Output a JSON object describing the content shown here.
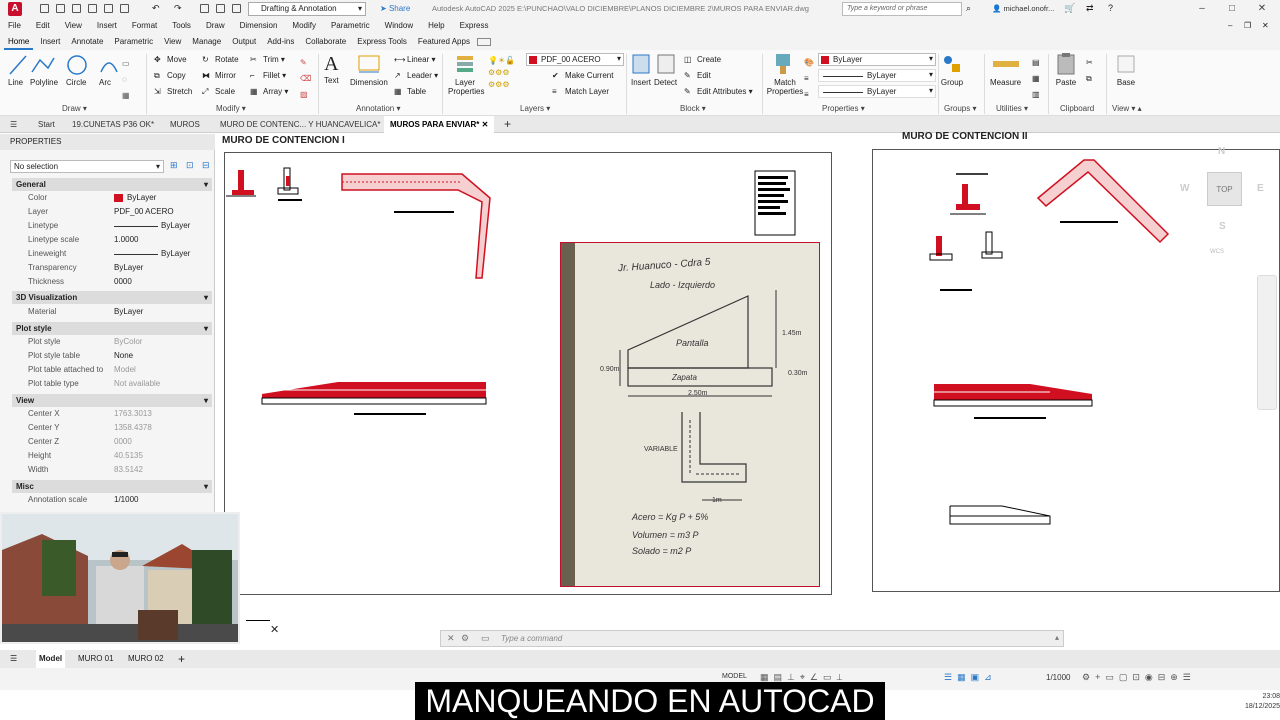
{
  "titlebar": {
    "app_logo": "A",
    "workspace": "Drafting & Annotation",
    "share": "Share",
    "title": "Autodesk AutoCAD 2025   E:\\PUNCHAO\\VALO DICIEMBRE\\PLANOS DICIEMBRE 2\\MUROS PARA ENVIAR.dwg",
    "search_placeholder": "Type a keyword or phrase",
    "user": "michael.onofr..."
  },
  "menu": [
    "File",
    "Edit",
    "View",
    "Insert",
    "Format",
    "Tools",
    "Draw",
    "Dimension",
    "Modify",
    "Parametric",
    "Window",
    "Help",
    "Express"
  ],
  "ribbon_tabs": [
    "Home",
    "Insert",
    "Annotate",
    "Parametric",
    "View",
    "Manage",
    "Output",
    "Add-ins",
    "Collaborate",
    "Express Tools",
    "Featured Apps"
  ],
  "ribbon": {
    "draw": {
      "line": "Line",
      "polyline": "Polyline",
      "circle": "Circle",
      "arc": "Arc",
      "label": "Draw"
    },
    "modify": {
      "move": "Move",
      "rotate": "Rotate",
      "trim": "Trim",
      "copy": "Copy",
      "mirror": "Mirror",
      "fillet": "Fillet",
      "stretch": "Stretch",
      "scale": "Scale",
      "array": "Array",
      "label": "Modify"
    },
    "annotation": {
      "text": "Text",
      "dimension": "Dimension",
      "linear": "Linear",
      "leader": "Leader",
      "table": "Table",
      "label": "Annotation"
    },
    "layers": {
      "layer_properties": "Layer Properties",
      "current_layer": "PDF_00 ACERO",
      "make_current": "Make Current",
      "match_layer": "Match Layer",
      "label": "Layers"
    },
    "block": {
      "insert": "Insert",
      "detect": "Detect",
      "create": "Create",
      "edit": "Edit",
      "edit_attributes": "Edit Attributes",
      "label": "Block"
    },
    "properties": {
      "match": "Match Properties",
      "color": "ByLayer",
      "linetype": "ByLayer",
      "lineweight": "ByLayer",
      "label": "Properties"
    },
    "groups": {
      "group": "Group",
      "label": "Groups"
    },
    "utilities": {
      "measure": "Measure",
      "label": "Utilities"
    },
    "clipboard": {
      "paste": "Paste",
      "label": "Clipboard"
    },
    "view": {
      "base": "Base",
      "label": "View"
    }
  },
  "doc_tabs": [
    "Start",
    "19.CUNETAS P36 OK*",
    "MUROS",
    "MURO DE CONTENC... Y HUANCAVELICA*",
    "MUROS PARA ENVIAR*"
  ],
  "properties": {
    "title": "PROPERTIES",
    "selection": "No selection",
    "sections": {
      "general": "General",
      "viz": "3D Visualization",
      "plot": "Plot style",
      "view": "View",
      "misc": "Misc"
    },
    "general": [
      {
        "label": "Color",
        "value": "ByLayer"
      },
      {
        "label": "Layer",
        "value": "PDF_00 ACERO"
      },
      {
        "label": "Linetype",
        "value": "ByLayer"
      },
      {
        "label": "Linetype scale",
        "value": "1.0000"
      },
      {
        "label": "Lineweight",
        "value": "ByLayer"
      },
      {
        "label": "Transparency",
        "value": "ByLayer"
      },
      {
        "label": "Thickness",
        "value": "0000"
      }
    ],
    "viz": [
      {
        "label": "Material",
        "value": "ByLayer"
      }
    ],
    "plot": [
      {
        "label": "Plot style",
        "value": "ByColor"
      },
      {
        "label": "Plot style table",
        "value": "None"
      },
      {
        "label": "Plot table attached to",
        "value": "Model"
      },
      {
        "label": "Plot table type",
        "value": "Not available"
      }
    ],
    "view": [
      {
        "label": "Center X",
        "value": "1763.3013"
      },
      {
        "label": "Center Y",
        "value": "1358.4378"
      },
      {
        "label": "Center Z",
        "value": "0000"
      },
      {
        "label": "Height",
        "value": "40.5135"
      },
      {
        "label": "Width",
        "value": "83.5142"
      }
    ],
    "misc": [
      {
        "label": "Annotation scale",
        "value": "1/1000"
      }
    ]
  },
  "drawing": {
    "title1": "MURO DE CONTENCION I",
    "title2": "MURO DE CONTENCION II",
    "viewcube": {
      "n": "N",
      "w": "W",
      "e": "E",
      "s": "S",
      "top": "TOP",
      "wcs": "WCS"
    },
    "sketch": {
      "line1": "Jr. Huanuco - Cdra 5",
      "line2": "Lado - Izquierdo",
      "pantalla": "Pantalla",
      "zapata": "Zapata",
      "dim1": "1.45m",
      "dim2": "0.30m",
      "dim3": "0.90m",
      "dim4": "2.50m",
      "variable": "VARIABLE",
      "dim5": "1m",
      "formula1": "Acero = Kg P + 5%",
      "formula2": "Volumen = m3 P",
      "formula3": "Solado = m2 P"
    }
  },
  "command_placeholder": "Type a command",
  "layout_tabs": [
    "Model",
    "MURO 01",
    "MURO 02"
  ],
  "status": {
    "model": "MODEL",
    "scale": "1/1000"
  },
  "banner": "MANQUEANDO EN AUTOCAD",
  "clock": {
    "time": "23:08",
    "date": "18/12/2025"
  },
  "colors": {
    "accent": "#2a78c8",
    "red": "#d01020",
    "brand": "#c8102e"
  }
}
